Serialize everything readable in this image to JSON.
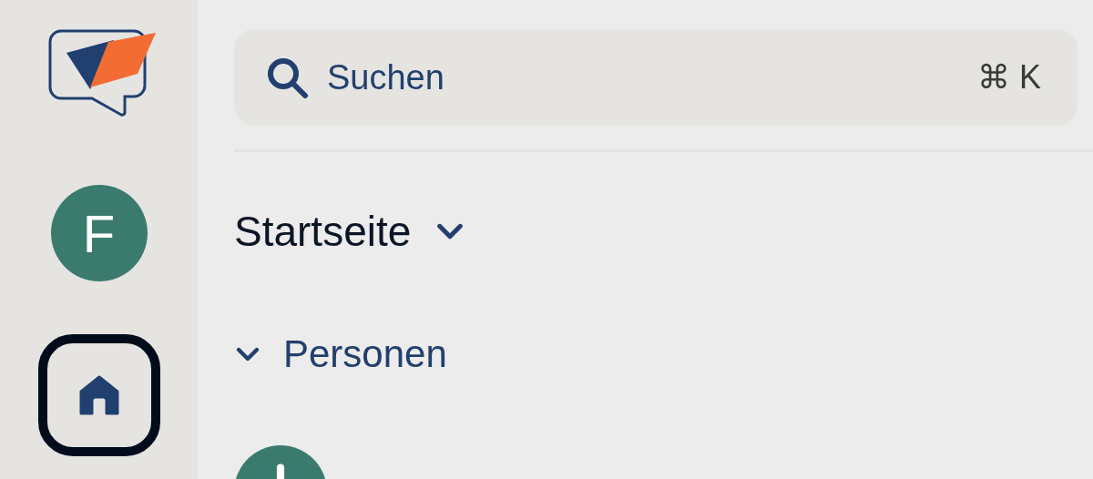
{
  "sidebar": {
    "user_initial": "F",
    "nav": [
      {
        "kind": "home",
        "selected": true
      }
    ]
  },
  "search": {
    "placeholder": "Suchen",
    "shortcut": "⌘ K"
  },
  "page_title": "Startseite",
  "sections": [
    {
      "title": "Personen",
      "expanded": true,
      "items": [
        {
          "kind": "avatar"
        }
      ]
    }
  ]
}
